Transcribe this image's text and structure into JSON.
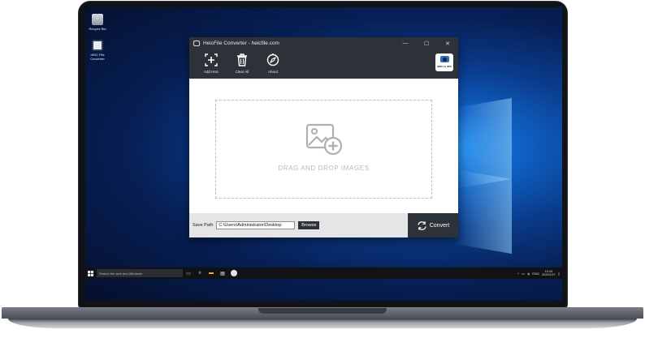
{
  "desktop": {
    "icons": [
      {
        "label": "Recycle Bin"
      },
      {
        "label": "HEIC File Converter"
      }
    ]
  },
  "window": {
    "title": "HeicFile Converter - heicfile.com",
    "controls": {
      "minimize": "—",
      "maximize": "☐",
      "close": "✕"
    }
  },
  "toolbar": {
    "add_label": "Add Heic",
    "clear_label": "Clear All",
    "about_label": "About",
    "badge_text": "HEIC to JPG"
  },
  "dropzone": {
    "text": "DRAG AND DROP IMAGES"
  },
  "bottom": {
    "save_path_label": "Save Path",
    "save_path_value": "C:\\Users\\Administrator\\Desktop",
    "browse_label": "Browse",
    "convert_label": "Convert"
  },
  "taskbar": {
    "search_placeholder": "Search the web and Windows",
    "language": "ENG",
    "time": "10:43",
    "date": "2020/1/27"
  },
  "colors": {
    "window_dark": "#2c3238",
    "accent": "#2c72b8",
    "dropzone_border": "#bcbcbc"
  }
}
